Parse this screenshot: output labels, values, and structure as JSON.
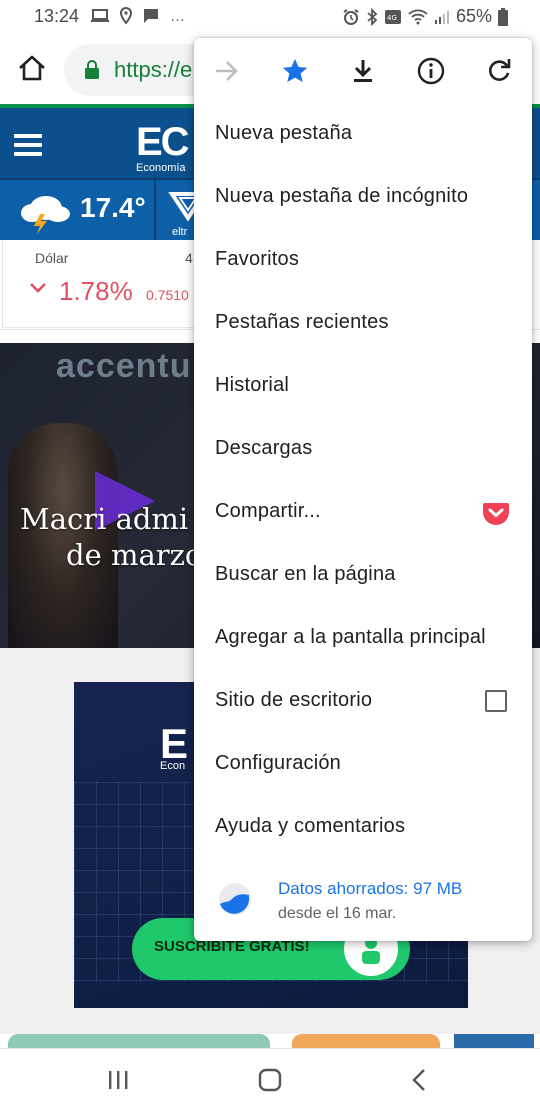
{
  "status_bar": {
    "time": "13:24",
    "overflow_dots": "…",
    "battery": "65%"
  },
  "toolbar": {
    "url": "https://e"
  },
  "page": {
    "logo": "EC",
    "logo_sub": "Economía",
    "temperature": "17.4°",
    "weather_brand": "eltr",
    "market_label": "Dólar",
    "market_label_2": "4",
    "market_change": "1.78%",
    "market_value": "0.7510",
    "hero_brand": "accentu",
    "hero_headline_1": "Macri admi",
    "hero_headline_2": "de marzo",
    "promo_logo": "E",
    "promo_sub": "Econ",
    "promo_cta": "SUSCRIBITE GRATIS!"
  },
  "menu": {
    "items": [
      {
        "label": "Nueva pestaña"
      },
      {
        "label": "Nueva pestaña de incógnito"
      },
      {
        "label": "Favoritos"
      },
      {
        "label": "Pestañas recientes"
      },
      {
        "label": "Historial"
      },
      {
        "label": "Descargas"
      },
      {
        "label": "Compartir..."
      },
      {
        "label": "Buscar en la página"
      },
      {
        "label": "Agregar a la pantalla principal"
      },
      {
        "label": "Sitio de escritorio"
      },
      {
        "label": "Configuración"
      },
      {
        "label": "Ayuda y comentarios"
      }
    ],
    "data_saver": {
      "title": "Datos ahorrados: 97 MB",
      "subtitle": "desde el 16 mar."
    },
    "desktop_site_checked": false
  },
  "icons": {
    "forward": "forward-arrow-icon",
    "bookmark": "star-icon",
    "download": "download-icon",
    "info": "info-icon",
    "reload": "reload-icon",
    "pocket": "pocket-icon"
  },
  "colors": {
    "accent_blue": "#1a73e8",
    "secure_green": "#188038",
    "site_blue": "#0b4f8c",
    "market_red": "#e05262",
    "cta_green": "#1ec86b"
  }
}
